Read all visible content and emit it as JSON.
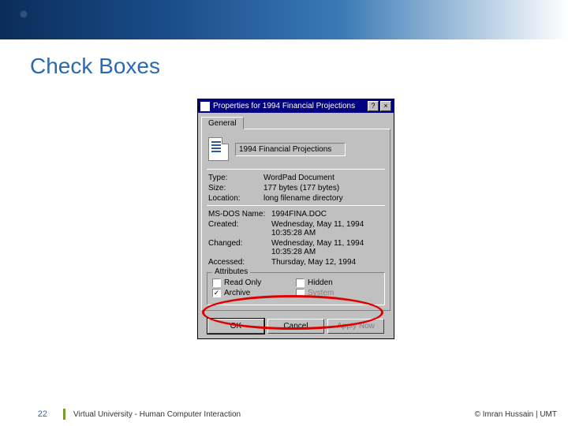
{
  "slide": {
    "title": "Check Boxes",
    "page_number": "22",
    "footer_center": "Virtual University - Human Computer Interaction",
    "footer_right": "© Imran Hussain | UMT"
  },
  "dialog": {
    "title": "Properties for 1994 Financial Projections",
    "help_btn": "?",
    "close_btn": "×",
    "tab": "General",
    "filename": "1994 Financial Projections",
    "rows": {
      "type": {
        "label": "Type:",
        "value": "WordPad Document"
      },
      "size": {
        "label": "Size:",
        "value": "177 bytes (177 bytes)"
      },
      "location": {
        "label": "Location:",
        "value": "long filename directory"
      },
      "msdos": {
        "label": "MS-DOS Name:",
        "value": "1994FINA.DOC"
      },
      "created": {
        "label": "Created:",
        "value": "Wednesday, May 11, 1994 10:35:28 AM"
      },
      "changed": {
        "label": "Changed:",
        "value": "Wednesday, May 11, 1994 10:35:28 AM"
      },
      "accessed": {
        "label": "Accessed:",
        "value": "Thursday, May 12, 1994"
      }
    },
    "attributes": {
      "group_label": "Attributes",
      "readonly": {
        "label": "Read Only",
        "checked": false,
        "enabled": true
      },
      "hidden": {
        "label": "Hidden",
        "checked": false,
        "enabled": true
      },
      "archive": {
        "label": "Archive",
        "checked": true,
        "enabled": true
      },
      "system": {
        "label": "System",
        "checked": false,
        "enabled": false
      }
    },
    "buttons": {
      "ok": "OK",
      "cancel": "Cancel",
      "apply": "Apply Now"
    }
  }
}
